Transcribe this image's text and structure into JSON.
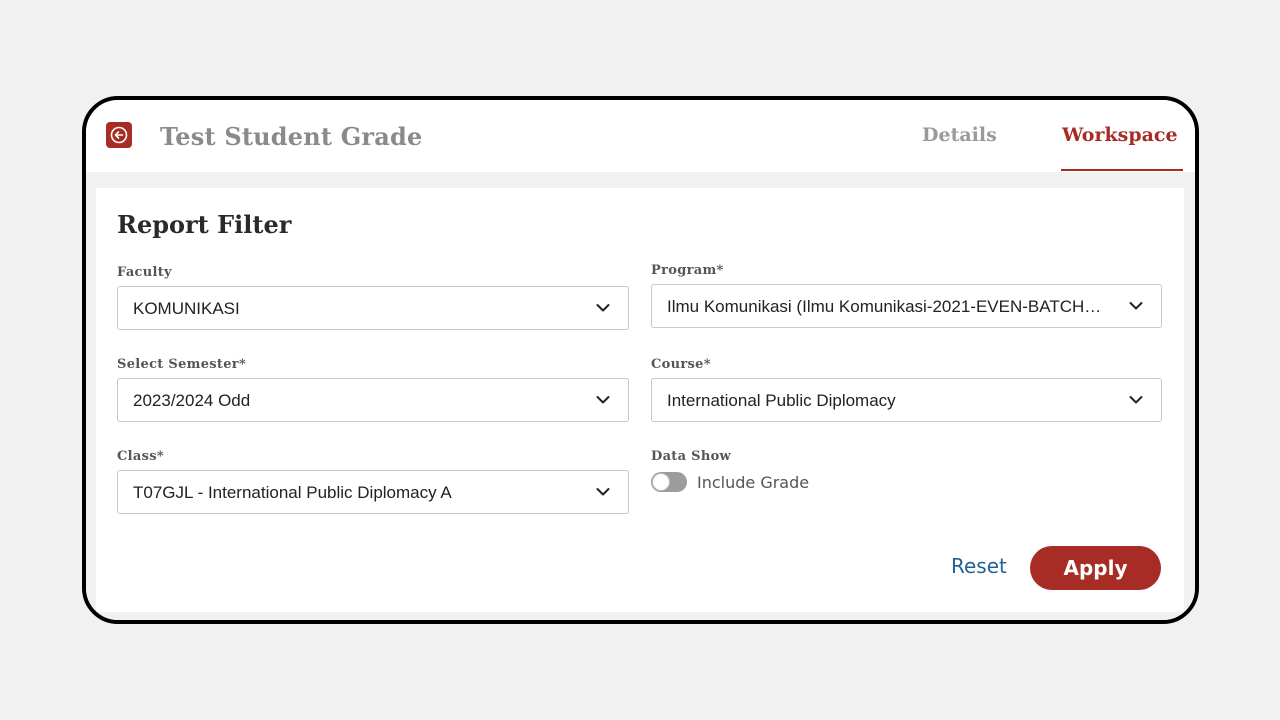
{
  "header": {
    "title": "Test Student Grade",
    "back_icon": "arrow-left-icon",
    "tabs": [
      {
        "label": "Details",
        "active": false
      },
      {
        "label": "Workspace",
        "active": true
      }
    ]
  },
  "filter": {
    "title": "Report Filter",
    "fields": {
      "faculty": {
        "label": "Faculty",
        "value": "KOMUNIKASI"
      },
      "program": {
        "label": "Program*",
        "value": "Ilmu Komunikasi (Ilmu Komunikasi-2021-EVEN-BATCH…"
      },
      "semester": {
        "label": "Select Semester*",
        "value": "2023/2024 Odd"
      },
      "course": {
        "label": "Course*",
        "value": "International Public Diplomacy"
      },
      "class": {
        "label": "Class*",
        "value": "T07GJL - International Public Diplomacy A"
      }
    },
    "data_show": {
      "label": "Data Show",
      "toggle_label": "Include Grade",
      "toggle_on": false
    },
    "actions": {
      "reset": "Reset",
      "apply": "Apply"
    }
  },
  "colors": {
    "accent": "#a72c25",
    "link": "#1e6296",
    "background": "#f1f1f1"
  }
}
